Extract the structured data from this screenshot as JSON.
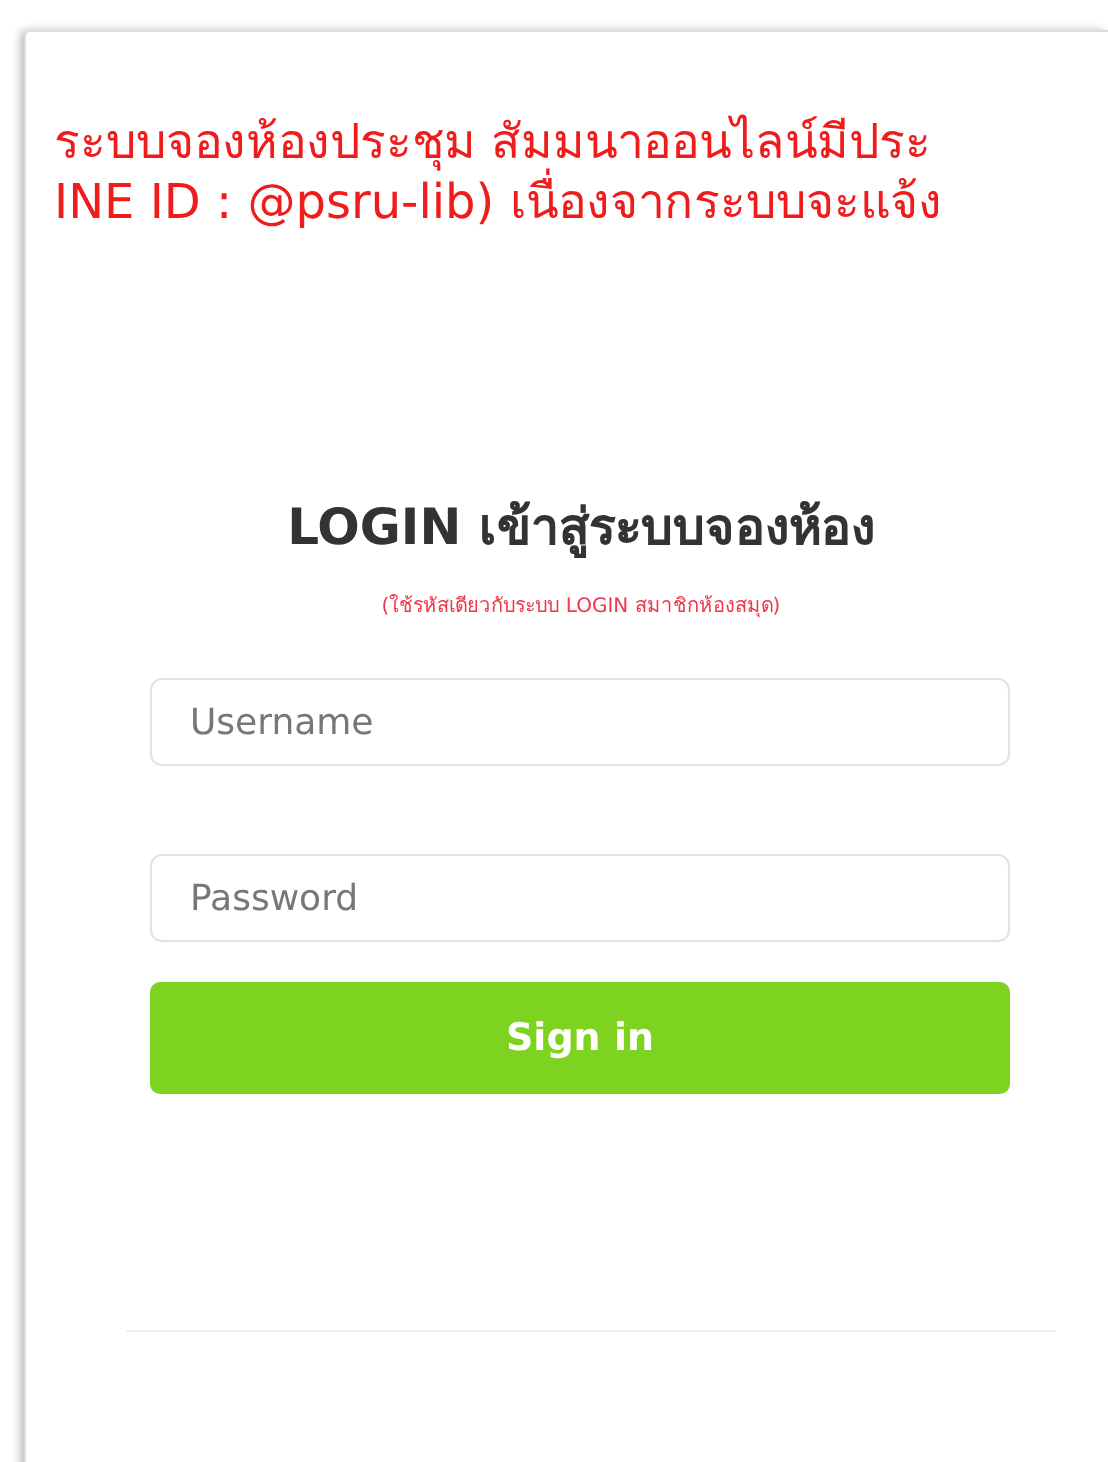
{
  "announcement": [
    "ระบบจองห้องประชุม สัมมนาออนไลน์มีประ",
    "INE ID : @psru-lib) เนื่องจากระบบจะแจ้ง"
  ],
  "login": {
    "title": "LOGIN เข้าสู่ระบบจองห้อง",
    "subtitle": "(ใช้รหัสเดียวกับระบบ LOGIN สมาชิกห้องสมุด)",
    "fields": [
      {
        "placeholder": "Username"
      },
      {
        "placeholder": "Password"
      }
    ],
    "button": "Sign in"
  }
}
